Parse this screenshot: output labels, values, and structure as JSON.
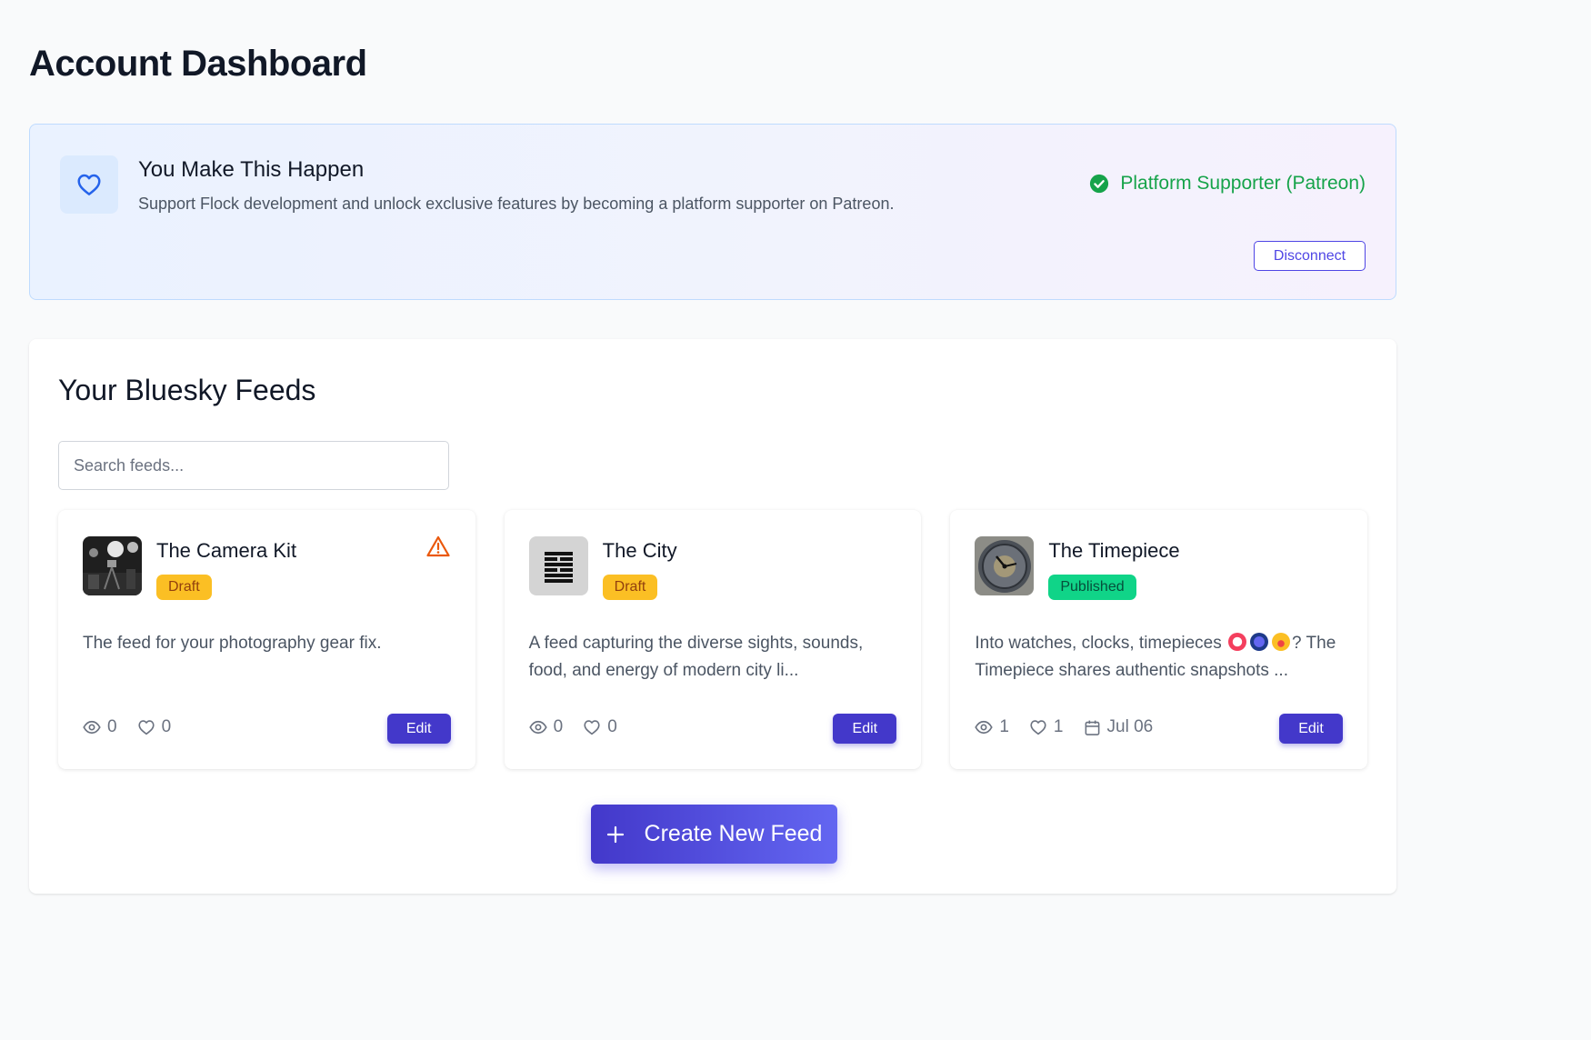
{
  "page": {
    "title": "Account Dashboard"
  },
  "support": {
    "title": "You Make This Happen",
    "description": "Support Flock development and unlock exclusive features by becoming a platform supporter on Patreon.",
    "status": "Platform Supporter (Patreon)",
    "disconnect_label": "Disconnect",
    "status_color": "#16a34a"
  },
  "feeds": {
    "title": "Your Bluesky Feeds",
    "search_placeholder": "Search feeds...",
    "create_label": "Create New Feed",
    "edit_label": "Edit",
    "items": [
      {
        "name": "The Camera Kit",
        "status": "Draft",
        "description": "The feed for your photography gear fix.",
        "views": "0",
        "likes": "0",
        "warning": true
      },
      {
        "name": "The City",
        "status": "Draft",
        "description": "A feed capturing the diverse sights, sounds, food, and energy of modern city li...",
        "views": "0",
        "likes": "0"
      },
      {
        "name": "The Timepiece",
        "status": "Published",
        "description_before": "Into watches, clocks, timepieces",
        "description_after": "? The Timepiece shares authentic snapshots ...",
        "views": "1",
        "likes": "1",
        "date": "Jul 06"
      }
    ]
  },
  "colors": {
    "accent": "#4338ca",
    "draft": "#fbbf24",
    "published": "#10d488",
    "warning": "#ea580c"
  }
}
